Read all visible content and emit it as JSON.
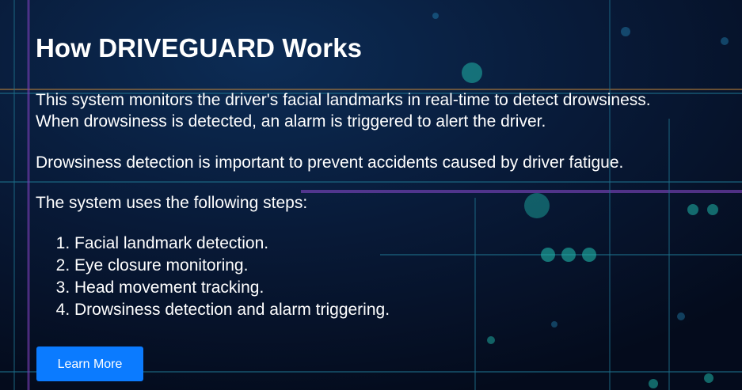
{
  "section": {
    "title": "How DRIVEGUARD Works",
    "intro_line1": "This system monitors the driver's facial landmarks in real-time to detect drowsiness.",
    "intro_line2": "When drowsiness is detected, an alarm is triggered to alert the driver.",
    "importance": "Drowsiness detection is important to prevent accidents caused by driver fatigue.",
    "steps_intro": "The system uses the following steps:",
    "steps": [
      "Facial landmark detection.",
      "Eye closure monitoring.",
      "Head movement tracking.",
      "Drowsiness detection and alarm triggering."
    ],
    "cta_label": "Learn More"
  },
  "colors": {
    "background": "#06122a",
    "button": "#0b7bff",
    "text": "#ffffff",
    "circuit_teal": "#1fb5a8",
    "circuit_purple": "#7a3fb8",
    "circuit_orange": "#c98a3a"
  }
}
